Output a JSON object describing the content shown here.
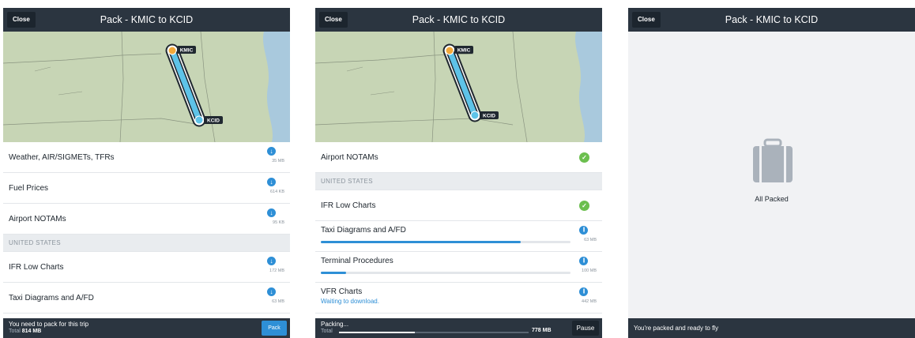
{
  "screens": [
    {
      "close_label": "Close",
      "title": "Pack - KMIC to KCID",
      "map": {
        "origin": "KMIC",
        "destination": "KCID"
      },
      "items": [
        {
          "label": "Weather, AIR/SIGMETs, TFRs",
          "size": "35 MB",
          "icon": "download-icon"
        },
        {
          "label": "Fuel Prices",
          "size": "614 KB",
          "icon": "download-icon"
        },
        {
          "label": "Airport NOTAMs",
          "size": "95 KB",
          "icon": "download-icon"
        }
      ],
      "section": "UNITED STATES",
      "section_items": [
        {
          "label": "IFR Low Charts",
          "size": "172 MB",
          "icon": "download-icon"
        },
        {
          "label": "Taxi Diagrams and A/FD",
          "size": "63 MB",
          "icon": "download-icon"
        }
      ],
      "bottom": {
        "message": "You need to pack for this trip",
        "total_label": "Total",
        "total_value": "814 MB",
        "button": "Pack"
      }
    },
    {
      "close_label": "Close",
      "title": "Pack - KMIC to KCID",
      "map": {
        "origin": "KMIC",
        "destination": "KCID"
      },
      "items": [
        {
          "label": "Airport NOTAMs",
          "status": "done",
          "icon": "check-icon"
        }
      ],
      "section": "UNITED STATES",
      "section_items": [
        {
          "label": "IFR Low Charts",
          "status": "done",
          "icon": "check-icon"
        },
        {
          "label": "Taxi Diagrams and A/FD",
          "size": "63 MB",
          "progress": 0.8,
          "icon": "pause-icon"
        },
        {
          "label": "Terminal Procedures",
          "size": "100 MB",
          "progress": 0.1,
          "icon": "pause-icon"
        },
        {
          "label": "VFR Charts",
          "sub": "Waiting to download.",
          "size": "442 MB",
          "icon": "pause-icon"
        }
      ],
      "bottom": {
        "message": "Packing...",
        "total_label": "Total",
        "total_value": "778 MB",
        "progress": 0.4,
        "button": "Pause"
      }
    },
    {
      "close_label": "Close",
      "title": "Pack - KMIC to KCID",
      "packed_label": "All Packed",
      "bottom": {
        "message": "You're packed and ready to fly"
      }
    }
  ],
  "colors": {
    "navbar": "#2b3540",
    "accent": "#2e8fd6",
    "success": "#6cbf4f",
    "route": "#5ec3e8",
    "origin": "#f2a93b",
    "map": "#c7d5b5"
  }
}
